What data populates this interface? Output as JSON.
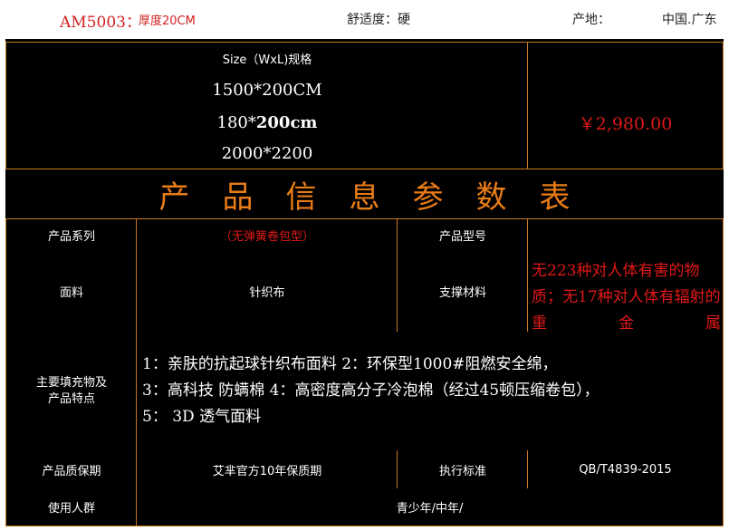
{
  "header": {
    "model_code": "AM5003：",
    "thickness": "厚度20CM",
    "comfort": "舒适度：硬",
    "origin_label": "产地：",
    "origin_value": "中国.广东"
  },
  "size_table": {
    "header": "Size（WxL)规格",
    "rows": [
      {
        "size_prefix": "1500*200CM",
        "size_bold": "",
        "price": ""
      },
      {
        "size_prefix": "180*",
        "size_bold": "200cm",
        "price": "￥2,980.00"
      },
      {
        "size_prefix": "2000*2200",
        "size_bold": "",
        "price": ""
      }
    ]
  },
  "params": {
    "title": "产品信息参数表",
    "series_label": "产品系列",
    "series_value": "（无弹簧卷包型）",
    "model_label": "产品型号",
    "model_value": "",
    "fabric_label": "面料",
    "fabric_value": "针织布",
    "support_label": "支撑材料",
    "support_value": "无223种对人体有害的物质；无17种对人体有辐射的重金属",
    "features_label": "主要填充物及产品特点",
    "features_lines": [
      "1：亲肤的抗起球针织布面料 2：环保型1000#阻燃安全绵，",
      "3：高科技 防螨棉 4：高密度高分子冷泡棉（经过45顿压缩卷包），",
      "5：  3D  透气面料"
    ],
    "warranty_label": "产品质保期",
    "warranty_value": "艾芈官方10年保质期",
    "standard_label": "执行标准",
    "standard_value": "QB/T4839-2015",
    "users_label": "使用人群",
    "users_value": "青少年/中年/"
  }
}
